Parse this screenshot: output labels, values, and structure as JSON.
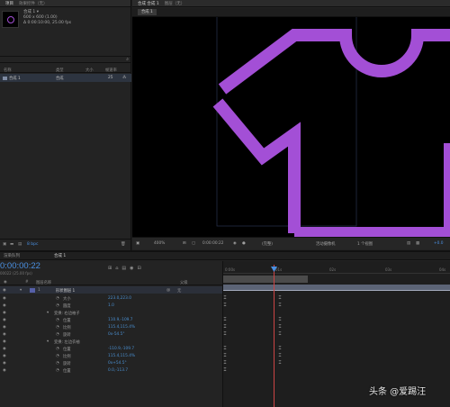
{
  "project": {
    "tabs": [
      "项目",
      "效果控件（无）"
    ],
    "comp_name": "合成 1 ▾",
    "comp_size": "600 x 600 (1.00)",
    "comp_duration": "Δ 0:00:10:00, 25.00 fps",
    "search_icon": "search-icon",
    "columns": [
      "名称",
      "类型",
      "大小",
      "帧速率"
    ],
    "item": {
      "name": "合成 1",
      "type": "合成",
      "fps": "25"
    },
    "bpc": "8 bpc"
  },
  "composition": {
    "top_tabs": [
      "合成 合成 1",
      "图层（无）"
    ],
    "sub_tab": "合成 1",
    "zoom": "400%",
    "timecode": "0:00:00:22",
    "resolution": "(完整)",
    "camera": "活动摄像机",
    "views": "1 个视图",
    "offset": "+0.0",
    "shape_color": "#a34fd6"
  },
  "timeline": {
    "tabs": [
      "渲染队列",
      "合成 1"
    ],
    "timecode": "0:00:00:22",
    "timecode_sub": "00022 (25.00 fps)",
    "columns": [
      "#",
      "图层名称",
      "父级"
    ],
    "ruler_ticks": [
      "0:00s",
      "01s",
      "02s",
      "03s",
      "04s"
    ],
    "layers": [
      {
        "num": "1",
        "name": "形状图层 1",
        "parent": "无"
      }
    ],
    "rows": [
      {
        "label": "大小",
        "value": "223.0,223.0"
      },
      {
        "label": "圆度",
        "value": "1.0"
      },
      {
        "label": "变换: 右边袖子",
        "value": ""
      },
      {
        "label": "位置",
        "value": "110.9,-109.7"
      },
      {
        "label": "比例",
        "value": "115.4,115.4%"
      },
      {
        "label": "旋转",
        "value": "0x-54.5°"
      },
      {
        "label": "变换: 左边衣袖",
        "value": ""
      },
      {
        "label": "位置",
        "value": "-110.9,-109.7"
      },
      {
        "label": "比例",
        "value": "115.4,115.4%"
      },
      {
        "label": "旋转",
        "value": "0x+54.5°"
      },
      {
        "label": "位置",
        "value": "0.0,-113.7"
      }
    ]
  },
  "watermark": "头条 @爱踢汪"
}
